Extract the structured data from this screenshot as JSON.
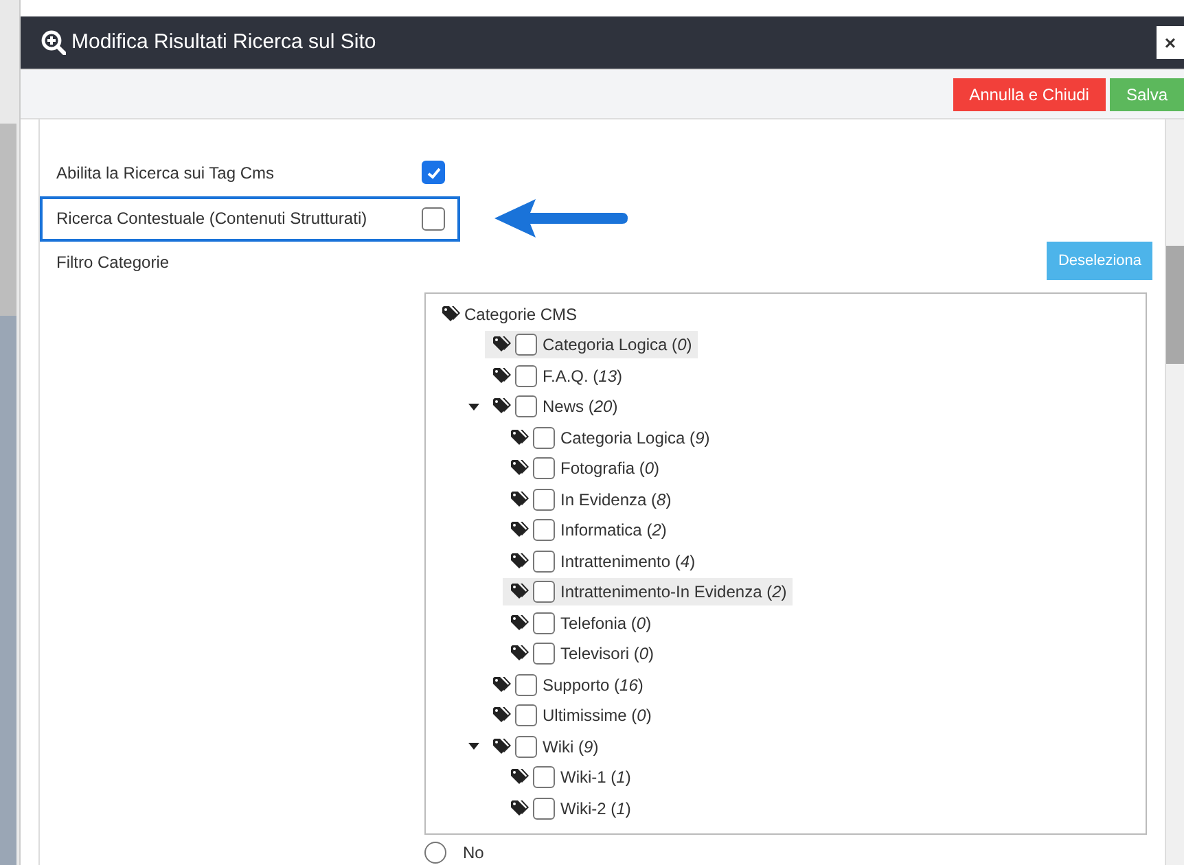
{
  "dialog": {
    "title": "Modifica Risultati Ricerca sul Sito",
    "close": "×"
  },
  "toolbar": {
    "buttons": [
      {
        "label": "Annulla e Chiudi",
        "kind": "cancel"
      },
      {
        "label": "Salva",
        "kind": "save"
      }
    ]
  },
  "options": [
    {
      "label": "Abilita la Ricerca sui Tag Cms",
      "checked": true,
      "focused": false
    },
    {
      "label": "Ricerca Contestuale (Contenuti Strutturati)",
      "checked": false,
      "focused": true
    }
  ],
  "filter": {
    "label": "Filtro Categorie",
    "button": "Deseleziona",
    "tree": {
      "label": "Categorie CMS",
      "children": [
        {
          "label": "Categoria Logica (*0*)",
          "checked": false,
          "highlighted": true
        },
        {
          "label": "F.A.Q. (*13*)",
          "checked": false,
          "highlighted": false
        },
        {
          "label": "News (*20*)",
          "checked": false,
          "highlighted": false,
          "expanded": true,
          "children": [
            {
              "label": "Categoria Logica (*9*)",
              "checked": false,
              "highlighted": false
            },
            {
              "label": "Fotografia (*0*)",
              "checked": false,
              "highlighted": false
            },
            {
              "label": "In Evidenza (*8*)",
              "checked": false,
              "highlighted": false
            },
            {
              "label": "Informatica (*2*)",
              "checked": false,
              "highlighted": false
            },
            {
              "label": "Intrattenimento (*4*)",
              "checked": false,
              "highlighted": false
            },
            {
              "label": "Intrattenimento-In Evidenza (*2*)",
              "checked": false,
              "highlighted": true
            },
            {
              "label": "Telefonia (*0*)",
              "checked": false,
              "highlighted": false
            },
            {
              "label": "Televisori (*0*)",
              "checked": false,
              "highlighted": false
            }
          ]
        },
        {
          "label": "Supporto (*16*)",
          "checked": false,
          "highlighted": false
        },
        {
          "label": "Ultimissime (*0*)",
          "checked": false,
          "highlighted": false
        },
        {
          "label": "Wiki (*9*)",
          "checked": false,
          "highlighted": false,
          "expanded": true,
          "children": [
            {
              "label": "Wiki-1 (*1*)",
              "checked": false,
              "highlighted": false
            },
            {
              "label": "Wiki-2 (*1*)",
              "checked": false,
              "highlighted": false
            }
          ]
        }
      ]
    }
  },
  "radio": {
    "label": "No",
    "selected": false
  }
}
